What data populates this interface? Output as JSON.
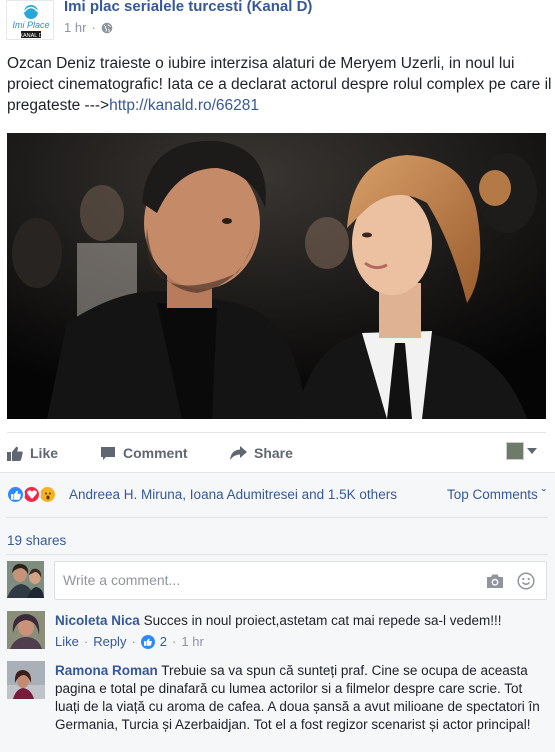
{
  "post": {
    "page_name": "Imi plac serialele turcesti (Kanal D)",
    "logo_text_1": "Imi Place",
    "logo_text_2": "KANAL D",
    "time": "1 hr",
    "separator": "·",
    "text": "Ozcan Deniz traieste o iubire interzisa alaturi de Meryem Uzerli, in noul lui proiect cinematografic! Iata ce a declarat actorul despre rolul complex pe care il pregateste --->",
    "link": "http://kanald.ro/66281"
  },
  "actions": {
    "like": "Like",
    "comment": "Comment",
    "share": "Share"
  },
  "reactions": {
    "names": "Andreea H. Miruna, Ioana Adumitresei and 1.5K others",
    "top_comments": "Top Comments ˇ",
    "shares": "19 shares"
  },
  "composer": {
    "placeholder": "Write a comment..."
  },
  "comments": [
    {
      "author": "Nicoleta Nica",
      "text": "Succes in noul proiect,astetam cat mai repede sa-l vedem!!!",
      "like": "Like",
      "reply": "Reply",
      "likes": "2",
      "time": "1 hr"
    },
    {
      "author": "Ramona Roman",
      "text": "Trebuie sa va spun că sunteți praf. Cine se ocupa de aceasta pagina e total pe dinafară cu lumea actorilor si a filmelor despre care scrie. Tot luați de la viață cu aroma de cafea. A doua șansă a avut milioane de spectatori în Germania, Turcia și Azerbaidjan. Tot el a fost regizor scenarist și actor principal!"
    }
  ],
  "colors": {
    "link": "#365899",
    "meta": "#90949c",
    "like_blue": "#2e89ff",
    "love_red": "#f0284a",
    "wow_yellow": "#f7b125"
  }
}
